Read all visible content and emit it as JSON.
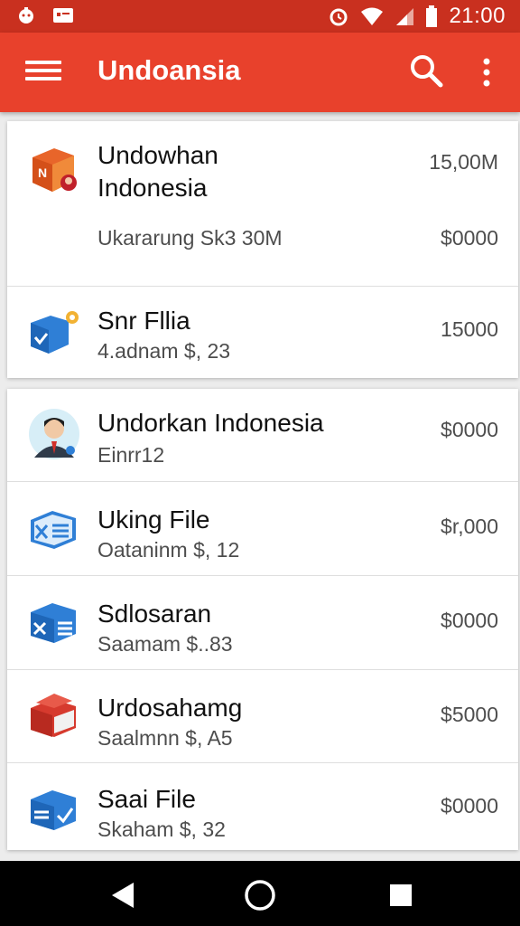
{
  "status_bar": {
    "time": "21:00"
  },
  "app_bar": {
    "title": "Undoansia"
  },
  "featured": {
    "title_line1": "Undowhan",
    "title_line2": "Indonesia",
    "top_amount": "15,00M",
    "subtitle": "Ukararung Sk3 30M",
    "amount": "$0000"
  },
  "items_top": [
    {
      "title": "Snr Fllia",
      "subtitle": "4.adnam $, 23",
      "amount": "15000",
      "icon": "box-gear-icon"
    }
  ],
  "items": [
    {
      "title": "Undorkan  Indonesia",
      "subtitle": "Einrr12",
      "amount": "$0000",
      "icon": "person-avatar-icon"
    },
    {
      "title": "Uking File",
      "subtitle": "Oataninm  $, 12",
      "amount": "$r,000",
      "icon": "blue-envelope-icon"
    },
    {
      "title": "Sdlosaran",
      "subtitle": "Saamam $..83",
      "amount": "$0000",
      "icon": "blue-box-icon"
    },
    {
      "title": "Urdosahamg",
      "subtitle": "Saalmnn $, A5",
      "amount": "$5000",
      "icon": "red-box-icon"
    },
    {
      "title": "Saai File",
      "subtitle": "Skaham  $, 32",
      "amount": "$0000",
      "icon": "blue-check-box-icon"
    }
  ],
  "colors": {
    "appbar": "#e8412c",
    "statusbar": "#c9301f",
    "navbar": "#000000"
  }
}
